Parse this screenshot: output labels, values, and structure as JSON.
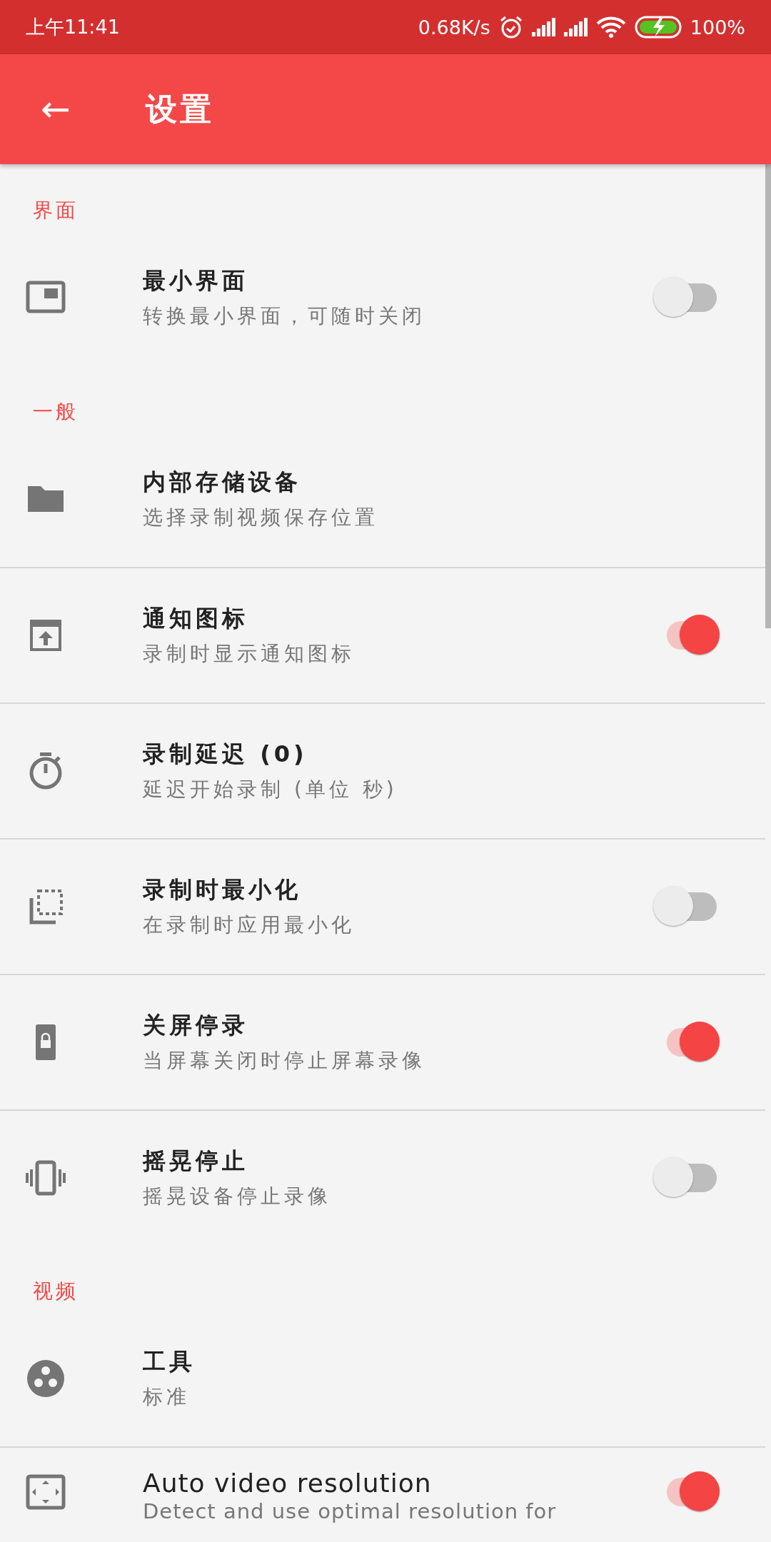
{
  "status_bar": {
    "time": "上午11:41",
    "speed": "0.68K/s",
    "battery": "100%"
  },
  "app_bar": {
    "back": "←",
    "title": "设置"
  },
  "sections": [
    {
      "header": "界面",
      "items": [
        {
          "kind": "switch",
          "title": "最小界面",
          "subtitle": "转换最小界面，可随时关闭",
          "on": false
        }
      ]
    },
    {
      "header": "一般",
      "items": [
        {
          "kind": "plain",
          "title": "内部存储设备",
          "subtitle": "选择录制视频保存位置"
        },
        {
          "kind": "switch",
          "title": "通知图标",
          "subtitle": "录制时显示通知图标",
          "on": true
        },
        {
          "kind": "plain",
          "title": "录制延迟 (0)",
          "subtitle": "延迟开始录制 (单位 秒)"
        },
        {
          "kind": "switch",
          "title": "录制时最小化",
          "subtitle": "在录制时应用最小化",
          "on": false
        },
        {
          "kind": "switch",
          "title": "关屏停录",
          "subtitle": "当屏幕关闭时停止屏幕录像",
          "on": true
        },
        {
          "kind": "switch",
          "title": "摇晃停止",
          "subtitle": "摇晃设备停止录像",
          "on": false
        }
      ]
    },
    {
      "header": "视频",
      "items": [
        {
          "kind": "plain",
          "title": "工具",
          "subtitle": "标准"
        },
        {
          "kind": "switch",
          "title": "Auto video resolution",
          "subtitle": "Detect and use optimal resolution for",
          "on": true
        }
      ]
    }
  ]
}
